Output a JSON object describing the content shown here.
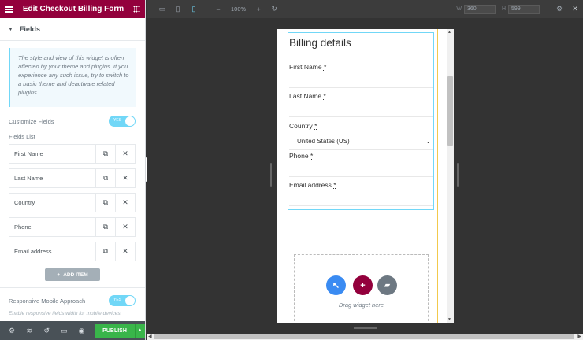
{
  "panel": {
    "title": "Edit Checkout Billing Form",
    "section_title": "Fields",
    "notice": "The style and view of this widget is often affected by your theme and plugins. If you experience any such issue, try to switch to a basic theme and deactivate related plugins.",
    "customize_fields_label": "Customize Fields",
    "customize_toggle": "YES",
    "fields_list_label": "Fields List",
    "fields": [
      {
        "label": "First Name"
      },
      {
        "label": "Last Name"
      },
      {
        "label": "Country"
      },
      {
        "label": "Phone"
      },
      {
        "label": "Email address"
      }
    ],
    "add_item_label": "ADD ITEM",
    "responsive_label": "Responsive Mobile Approach",
    "responsive_toggle": "YES",
    "responsive_help": "Enable responsive fields width for mobile devices."
  },
  "footer": {
    "publish_label": "PUBLISH"
  },
  "toolbar": {
    "zoom": "100%",
    "width_label": "W",
    "width_value": "360",
    "height_label": "H",
    "height_value": "599"
  },
  "preview": {
    "billing_title": "Billing details",
    "fields": [
      {
        "label": "First Name",
        "required": "*"
      },
      {
        "label": "Last Name",
        "required": "*"
      },
      {
        "label": "Country",
        "required": "*"
      },
      {
        "label": "Phone",
        "required": "*"
      },
      {
        "label": "Email address",
        "required": "*"
      }
    ],
    "country_value": "United States (US)",
    "drop_text": "Drag widget here"
  },
  "colors": {
    "brand": "#93003c",
    "accent": "#71d7f7",
    "publish": "#39b54a",
    "drag_blue": "#3a8bf2",
    "drag_gray": "#6d7882"
  }
}
